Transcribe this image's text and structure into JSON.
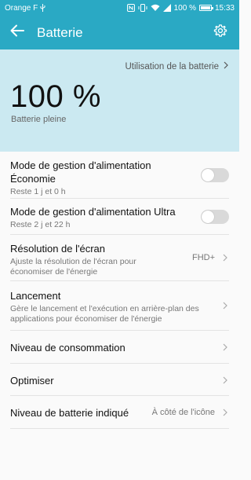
{
  "statusbar": {
    "carrier": "Orange F",
    "battery_percent": "100 %",
    "time": "15:33",
    "icons": [
      "usb-icon",
      "nfc-icon",
      "vibrate-icon",
      "wifi-icon",
      "signal-icon",
      "battery-icon"
    ]
  },
  "appbar": {
    "title": "Batterie",
    "back_icon": "arrow-left-icon",
    "settings_icon": "gear-icon"
  },
  "header": {
    "usage_link": "Utilisation de la batterie",
    "percent": "100 %",
    "status": "Batterie pleine"
  },
  "items": [
    {
      "title": "Mode de gestion d'alimentation Économie",
      "subtitle": "Reste 1 j et 0 h",
      "control": "toggle",
      "enabled": false
    },
    {
      "title": "Mode de gestion d'alimentation Ultra",
      "subtitle": "Reste 2 j et 22 h",
      "control": "toggle",
      "enabled": false
    },
    {
      "title": "Résolution de l'écran",
      "subtitle": "Ajuste la résolution de l'écran pour économiser de l'énergie",
      "value": "FHD+",
      "control": "chevron"
    },
    {
      "title": "Lancement",
      "subtitle": "Gère le lancement et l'exécution en arrière-plan des applications pour économiser de l'énergie",
      "control": "chevron"
    },
    {
      "title": "Niveau de consommation",
      "control": "chevron"
    },
    {
      "title": "Optimiser",
      "control": "chevron"
    },
    {
      "title": "Niveau de batterie indiqué",
      "value": "À côté de l'icône",
      "control": "chevron"
    }
  ],
  "colors": {
    "accent": "#2aa9c4",
    "header_bg": "#cbe9f1",
    "toggle_off": "#d9d9d9"
  }
}
